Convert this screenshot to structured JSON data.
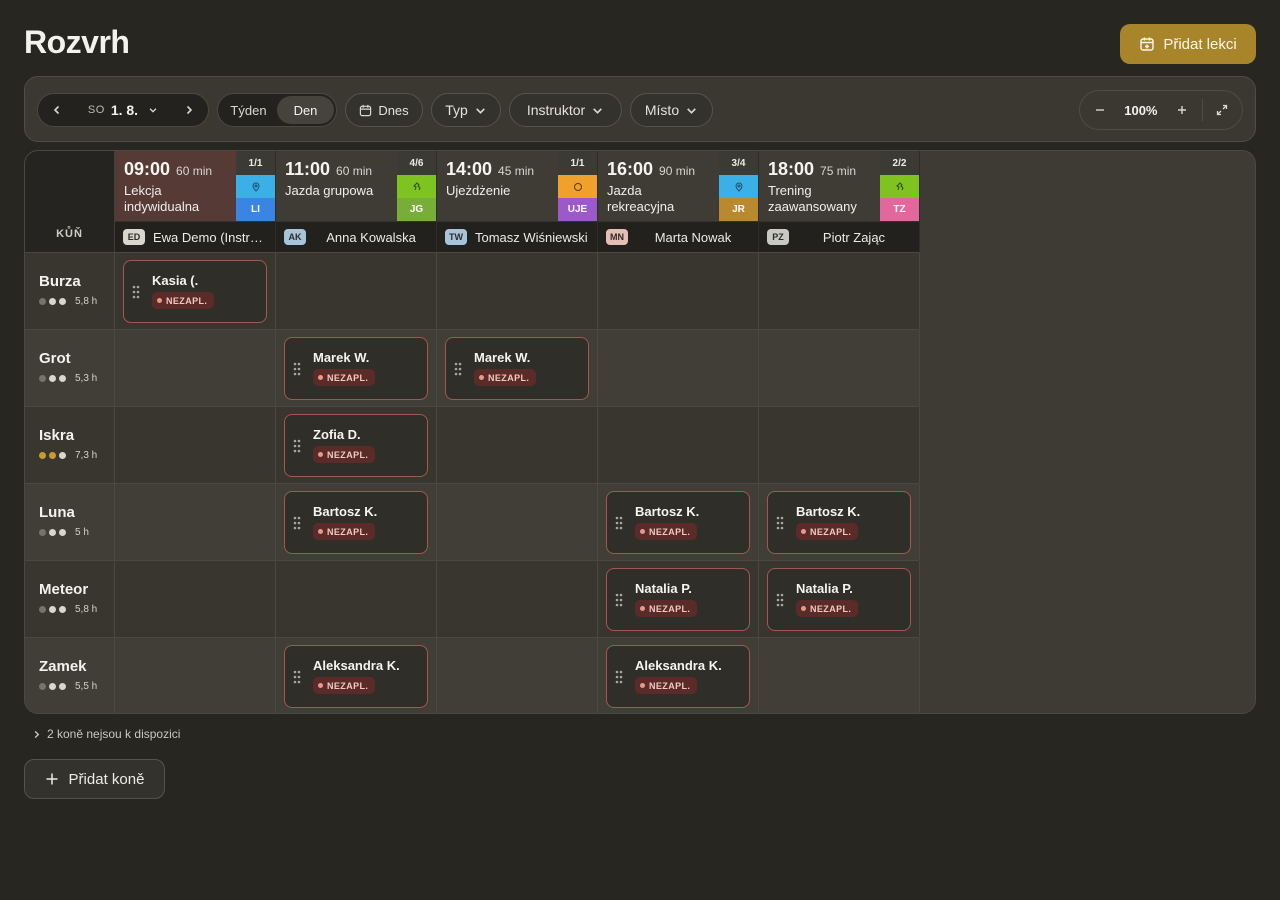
{
  "page_title": "Rozvrh",
  "add_lesson_label": "Přidat lekci",
  "toolbar": {
    "date_dow": "SO",
    "date_value": "1. 8.",
    "view_week": "Týden",
    "view_day": "Den",
    "today": "Dnes",
    "filter_type": "Typ",
    "filter_instructor": "Instruktor",
    "filter_place": "Místo",
    "zoom": "100%"
  },
  "grid": {
    "horse_col_header": "KŮŇ",
    "lessons": [
      {
        "time": "09:00",
        "duration": "60 min",
        "name": "Lekcja indywidualna",
        "capacity": "1/1",
        "icon": "location-icon",
        "icon_color": "#3bb0e6",
        "code": "LI",
        "code_color": "#3a84e4",
        "head_bg": "#553a36",
        "instructor_initials": "ED",
        "instructor_initials_bg": "#d9d6cd",
        "instructor": "Ewa Demo (Instruktor)"
      },
      {
        "time": "11:00",
        "duration": "60 min",
        "name": "Jazda grupowa",
        "capacity": "4/6",
        "icon": "horse-icon",
        "icon_color": "#7ec31f",
        "code": "JG",
        "code_color": "#78ad3a",
        "head_bg": "#3e3c35",
        "instructor_initials": "AK",
        "instructor_initials_bg": "#a8c4db",
        "instructor": "Anna Kowalska"
      },
      {
        "time": "14:00",
        "duration": "45 min",
        "name": "Ujeżdżenie",
        "capacity": "1/1",
        "icon": "target-icon",
        "icon_color": "#f0a12c",
        "code": "UJE",
        "code_color": "#9b59c9",
        "head_bg": "#3e3c35",
        "instructor_initials": "TW",
        "instructor_initials_bg": "#a8c4db",
        "instructor": "Tomasz Wiśniewski"
      },
      {
        "time": "16:00",
        "duration": "90 min",
        "name": "Jazda rekreacyjna",
        "capacity": "3/4",
        "icon": "location-icon",
        "icon_color": "#3bb0e6",
        "code": "JR",
        "code_color": "#b8892e",
        "head_bg": "#3e3c35",
        "instructor_initials": "MN",
        "instructor_initials_bg": "#e3bfb5",
        "instructor": "Marta Nowak"
      },
      {
        "time": "18:00",
        "duration": "75 min",
        "name": "Trening zaawansowany",
        "capacity": "2/2",
        "icon": "horse-icon",
        "icon_color": "#7ec31f",
        "code": "TZ",
        "code_color": "#e0689c",
        "head_bg": "#3e3c35",
        "instructor_initials": "PZ",
        "instructor_initials_bg": "#c9c9c4",
        "instructor": "Piotr Zając"
      }
    ],
    "horses": [
      {
        "name": "Burza",
        "hours": "5,8 h",
        "dots": [
          "dim",
          "light",
          "light"
        ],
        "bookings": [
          {
            "col": 0,
            "name": "Kasia (.",
            "status": "NEZAPL."
          }
        ]
      },
      {
        "name": "Grot",
        "hours": "5,3 h",
        "dots": [
          "dim",
          "light",
          "light"
        ],
        "bookings": [
          {
            "col": 1,
            "name": "Marek W.",
            "status": "NEZAPL."
          },
          {
            "col": 2,
            "name": "Marek W.",
            "status": "NEZAPL."
          }
        ]
      },
      {
        "name": "Iskra",
        "hours": "7,3 h",
        "dots": [
          "gold",
          "gold",
          "light"
        ],
        "bookings": [
          {
            "col": 1,
            "name": "Zofia D.",
            "status": "NEZAPL."
          }
        ]
      },
      {
        "name": "Luna",
        "hours": "5 h",
        "dots": [
          "dim",
          "light",
          "light"
        ],
        "bookings": [
          {
            "col": 1,
            "name": "Bartosz K.",
            "status": "NEZAPL."
          },
          {
            "col": 3,
            "name": "Bartosz K.",
            "status": "NEZAPL."
          },
          {
            "col": 4,
            "name": "Bartosz K.",
            "status": "NEZAPL."
          }
        ]
      },
      {
        "name": "Meteor",
        "hours": "5,8 h",
        "dots": [
          "dim",
          "light",
          "light"
        ],
        "bookings": [
          {
            "col": 3,
            "name": "Natalia P.",
            "status": "NEZAPL."
          },
          {
            "col": 4,
            "name": "Natalia P.",
            "status": "NEZAPL."
          }
        ]
      },
      {
        "name": "Zamek",
        "hours": "5,5 h",
        "dots": [
          "dim",
          "light",
          "light"
        ],
        "bookings": [
          {
            "col": 1,
            "name": "Aleksandra K.",
            "status": "NEZAPL."
          },
          {
            "col": 3,
            "name": "Aleksandra K.",
            "status": "NEZAPL."
          }
        ]
      }
    ]
  },
  "unavailable_label": "2 koně nejsou k dispozici",
  "add_horse_label": "Přidat koně"
}
